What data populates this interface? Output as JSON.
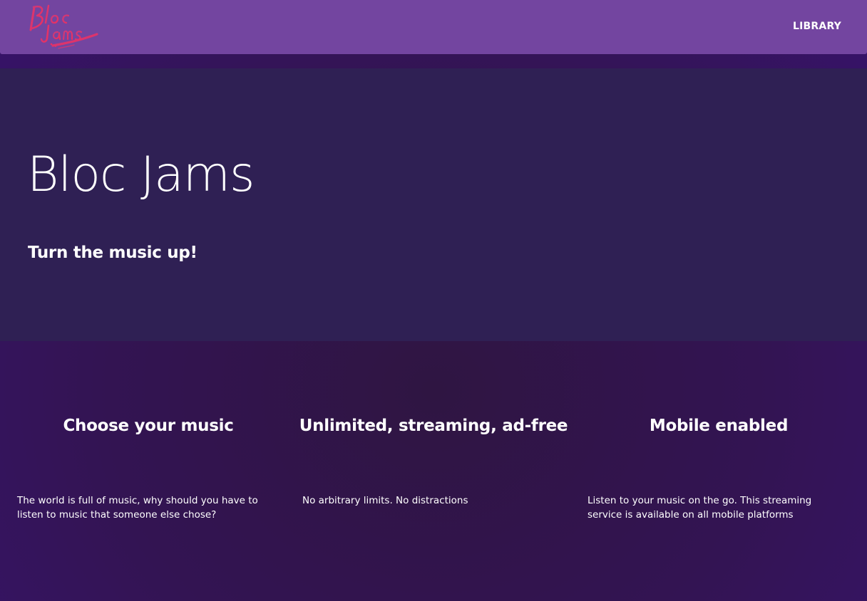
{
  "navbar": {
    "logo_text": "Bloc Jams",
    "library_link": "LIBRARY"
  },
  "hero": {
    "title": "Bloc Jams",
    "subtitle": "Turn the music up!"
  },
  "selling_points": [
    {
      "title": "Choose your music",
      "description": "The world is full of music, why should you have to listen to music that someone else chose?"
    },
    {
      "title": "Unlimited, streaming, ad-free",
      "description": "No arbitrary limits. No distractions"
    },
    {
      "title": "Mobile enabled",
      "description": "Listen to your music on the go. This streaming service is available on all mobile platforms"
    }
  ],
  "colors": {
    "navbar": "#7345a0",
    "hero": "#2f2054",
    "page_background": "#331453",
    "logo": "#e0336b"
  }
}
